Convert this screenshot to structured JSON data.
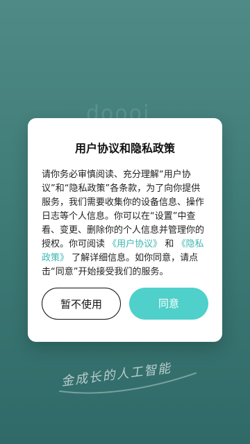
{
  "background": {
    "logo_text": "doooi"
  },
  "dialog": {
    "title": "用户协议和隐私政策",
    "body": {
      "p1": "请你务必审慎阅读、充分理解“用户协议”和“隐私政策”各条款，为了向你提供服务，我们需要收集你的设备信息、操作日志等个人信息。你可以在“设置”中查看、变更、删除你的个人信息并管理你的授权。你可阅读",
      "link_user_agreement": "《用户协议》",
      "and": "和",
      "link_privacy_policy": "《隐私政策》",
      "p2": "了解详细信息。如你同意，请点击“同意”开始接受我们的服务。"
    },
    "buttons": {
      "decline": "暂不使用",
      "agree": "同意"
    }
  },
  "footer": {
    "signature_text": "金成长的人工智能"
  },
  "colors": {
    "background_top": "#4f8a86",
    "background_bottom": "#2f6a68",
    "accent": "#4fd0ca",
    "link": "#3bb7b0"
  }
}
